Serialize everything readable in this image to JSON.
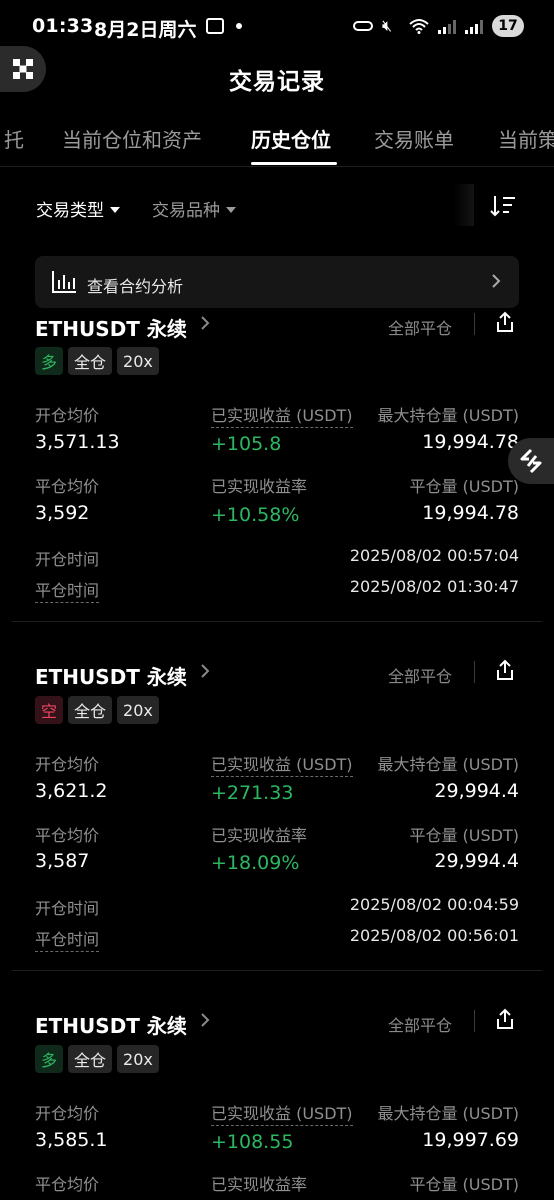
{
  "status_bar": {
    "time": "01:33",
    "date": "8月2日周六",
    "battery": "17"
  },
  "header": {
    "title": "交易记录"
  },
  "tabs": [
    {
      "label": "托"
    },
    {
      "label": "当前仓位和资产"
    },
    {
      "label": "历史仓位"
    },
    {
      "label": "交易账单"
    },
    {
      "label": "当前策"
    }
  ],
  "filters": {
    "trade_type": "交易类型",
    "instrument": "交易品种"
  },
  "analysis": {
    "label": "查看合约分析"
  },
  "colors": {
    "profit_green": "#2bb861",
    "short_red": "#e8455f",
    "background": "#000000"
  },
  "positions": [
    {
      "symbol": "ETHUSDT 永续",
      "close_type": "全部平仓",
      "side": "多",
      "margin_mode": "全仓",
      "leverage": "20x",
      "open_avg_label": "开仓均价",
      "open_avg": "3,571.13",
      "realized_pnl_label": "已实现收益 (USDT)",
      "realized_pnl": "+105.8",
      "max_position_label": "最大持仓量 (USDT)",
      "max_position": "19,994.78",
      "close_avg_label": "平仓均价",
      "close_avg": "3,592",
      "realized_rate_label": "已实现收益率",
      "realized_rate": "+10.58%",
      "closed_amount_label": "平仓量 (USDT)",
      "closed_amount": "19,994.78",
      "open_time_label": "开仓时间",
      "open_time": "2025/08/02 00:57:04",
      "close_time_label": "平仓时间",
      "close_time": "2025/08/02 01:30:47"
    },
    {
      "symbol": "ETHUSDT 永续",
      "close_type": "全部平仓",
      "side": "空",
      "margin_mode": "全仓",
      "leverage": "20x",
      "open_avg_label": "开仓均价",
      "open_avg": "3,621.2",
      "realized_pnl_label": "已实现收益 (USDT)",
      "realized_pnl": "+271.33",
      "max_position_label": "最大持仓量 (USDT)",
      "max_position": "29,994.4",
      "close_avg_label": "平仓均价",
      "close_avg": "3,587",
      "realized_rate_label": "已实现收益率",
      "realized_rate": "+18.09%",
      "closed_amount_label": "平仓量 (USDT)",
      "closed_amount": "29,994.4",
      "open_time_label": "开仓时间",
      "open_time": "2025/08/02 00:04:59",
      "close_time_label": "平仓时间",
      "close_time": "2025/08/02 00:56:01"
    },
    {
      "symbol": "ETHUSDT 永续",
      "close_type": "全部平仓",
      "side": "多",
      "margin_mode": "全仓",
      "leverage": "20x",
      "open_avg_label": "开仓均价",
      "open_avg": "3,585.1",
      "realized_pnl_label": "已实现收益 (USDT)",
      "realized_pnl": "+108.55",
      "max_position_label": "最大持仓量 (USDT)",
      "max_position": "19,997.69",
      "close_avg_label": "平仓均价",
      "realized_rate_label": "已实现收益率",
      "closed_amount_label": "平仓量 (USDT)"
    }
  ]
}
